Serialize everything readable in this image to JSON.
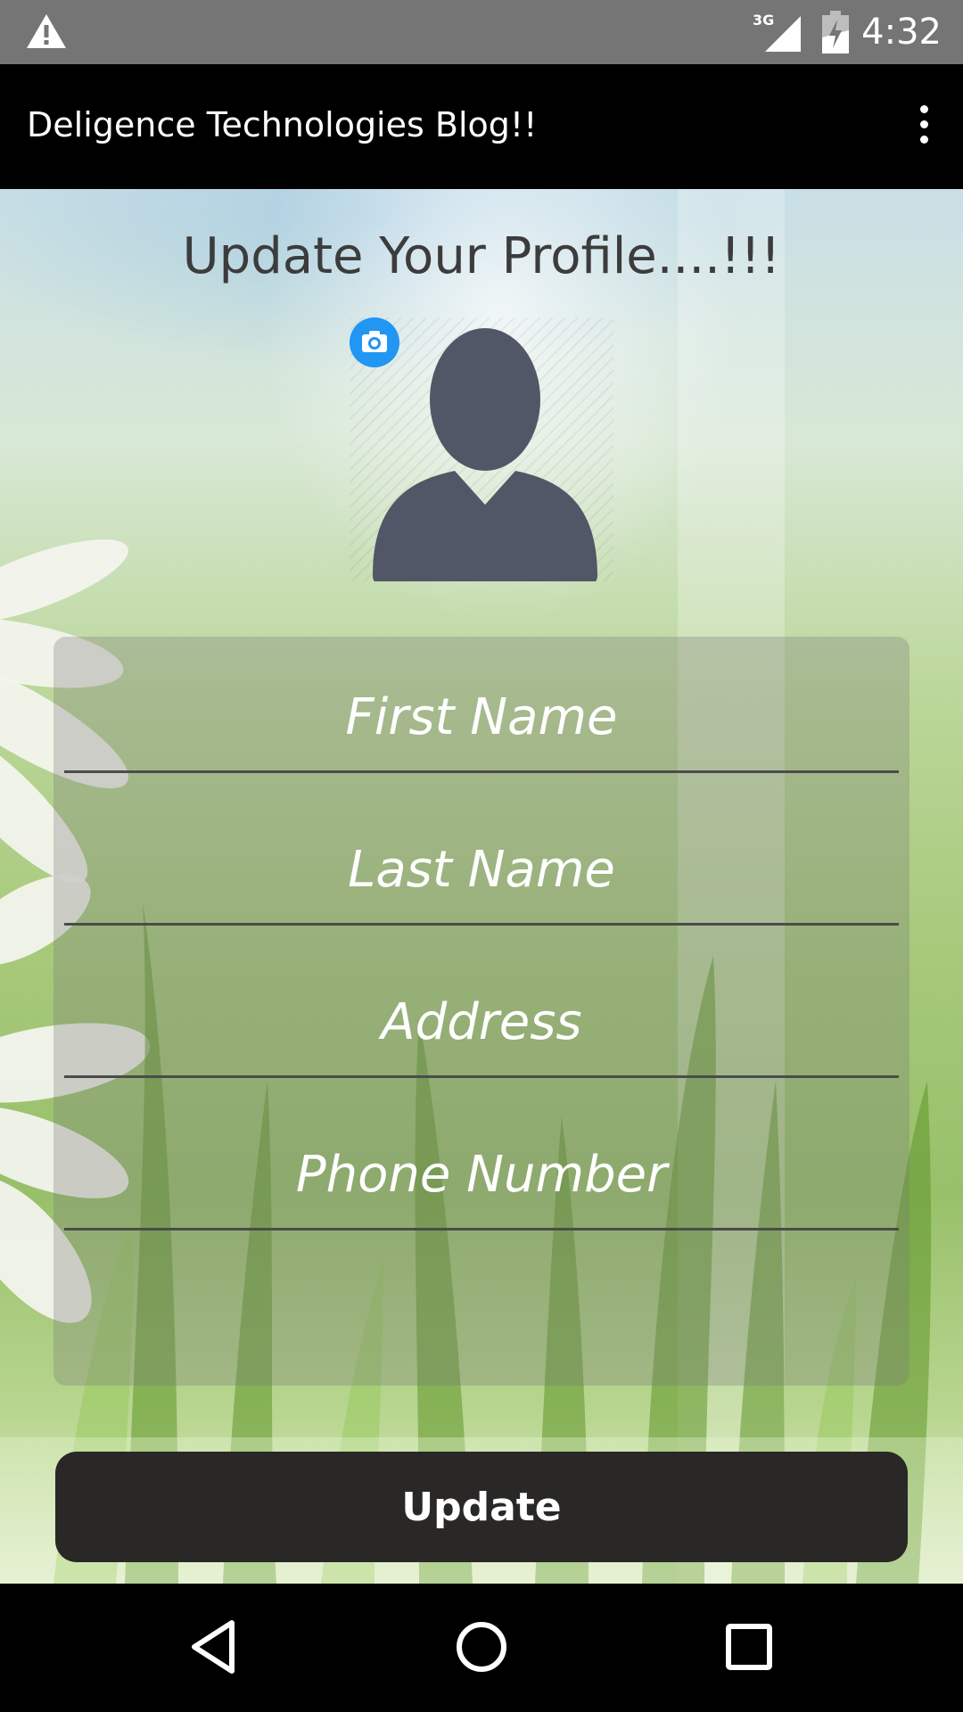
{
  "status_bar": {
    "time": "4:32",
    "network": "3G",
    "icons": [
      "warning-icon",
      "signal-icon",
      "battery-icon"
    ]
  },
  "app_bar": {
    "title": "Deligence Technologies Blog!!",
    "menu_icon": "overflow-menu-icon"
  },
  "page": {
    "title": "Update Your Profile....!!!"
  },
  "avatar": {
    "icon": "person-avatar-icon",
    "badge_icon": "camera-icon",
    "badge_color": "#2196f3"
  },
  "form": {
    "first_name": {
      "value": "",
      "placeholder": "First Name"
    },
    "last_name": {
      "value": "",
      "placeholder": "Last Name"
    },
    "address": {
      "value": "",
      "placeholder": "Address"
    },
    "phone": {
      "value": "",
      "placeholder": "Phone Number"
    }
  },
  "actions": {
    "update_label": "Update"
  },
  "nav_bar": {
    "icons": [
      "back-icon",
      "home-icon",
      "recents-icon"
    ]
  }
}
